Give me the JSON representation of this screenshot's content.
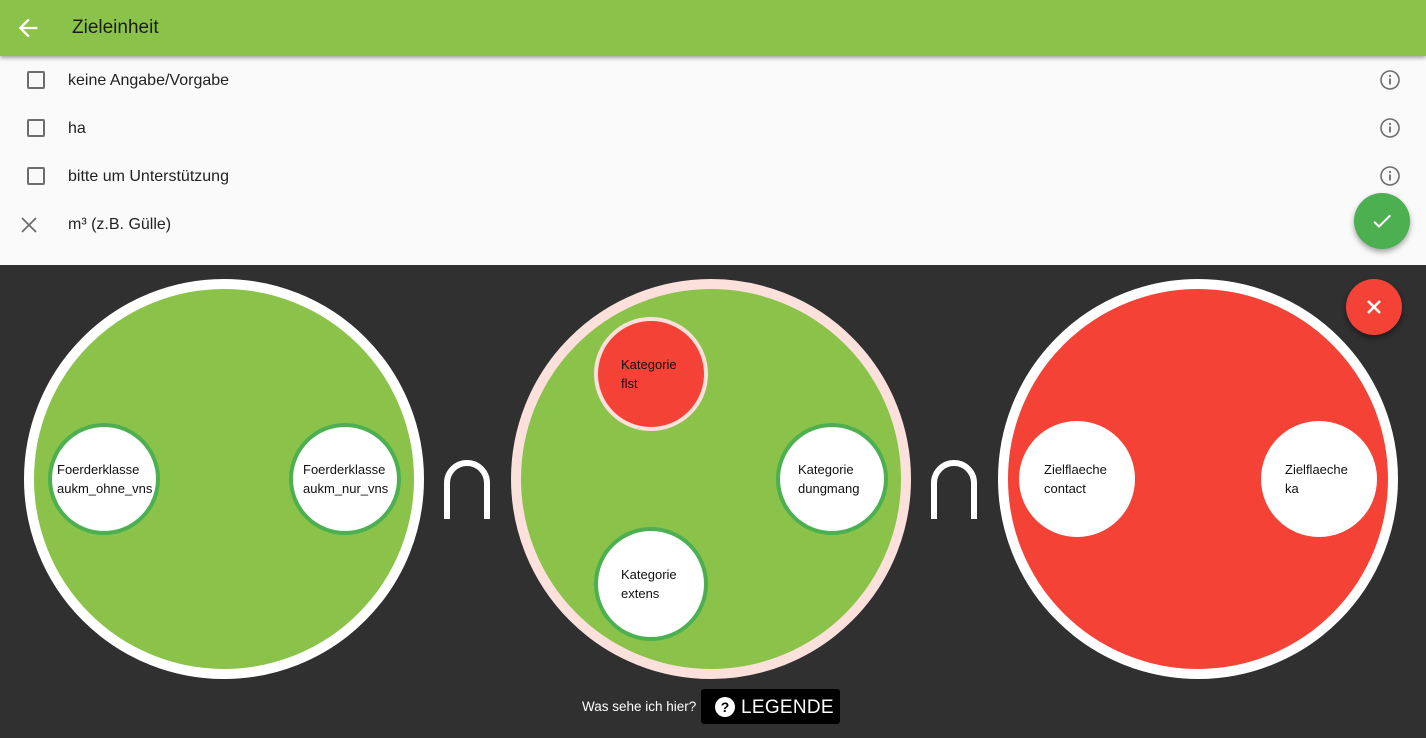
{
  "appbar": {
    "title": "Zieleinheit",
    "back_icon": "arrow-back-icon"
  },
  "options": [
    {
      "label": "keine Angabe/Vorgabe",
      "checked": false,
      "has_info": true
    },
    {
      "label": "ha",
      "checked": false,
      "has_info": true
    },
    {
      "label": "bitte um Unterstützung",
      "checked": false,
      "has_info": true
    },
    {
      "label": "m³ (z.B. Gülle)",
      "excluded": true,
      "has_info": false
    }
  ],
  "fab_confirm": {
    "icon": "check-icon",
    "color": "#4caf50"
  },
  "fab_close": {
    "icon": "close-icon",
    "color": "#f44336"
  },
  "sets": [
    {
      "color": "#8bc34a",
      "border": "#ffffff",
      "items": [
        {
          "line1": "Foerderklasse",
          "line2": "aukm_ohne_vns"
        },
        {
          "line1": "Foerderklasse",
          "line2": "aukm_nur_vns"
        }
      ]
    },
    {
      "color": "#8bc34a",
      "border": "#fbe0dc",
      "items": [
        {
          "line1": "Kategorie",
          "line2": "flst",
          "color": "#f44336"
        },
        {
          "line1": "Kategorie",
          "line2": "dungmang"
        },
        {
          "line1": "Kategorie",
          "line2": "extens"
        }
      ]
    },
    {
      "color": "#f44336",
      "border": "#ffffff",
      "items": [
        {
          "line1": "Zielflaeche",
          "line2": "contact"
        },
        {
          "line1": "Zielflaeche",
          "line2": "ka"
        }
      ]
    }
  ],
  "operator_symbol": "∩",
  "legend": {
    "question": "Was sehe ich hier?",
    "button_label": "LEGENDE",
    "icon": "help-circle-icon"
  }
}
